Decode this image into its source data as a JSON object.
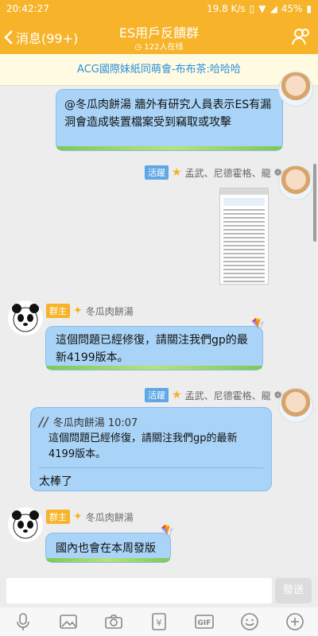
{
  "status": {
    "time": "20:42:27",
    "network": "19.8 K/s",
    "battery": "45%"
  },
  "header": {
    "back_label": "消息(99+)",
    "title": "ES用戶反饋群",
    "online": "122人在线"
  },
  "banner": {
    "text": "ACG國際妹紙同萌會-布布茶:哈哈哈"
  },
  "messages": [
    {
      "text": "@冬瓜肉餅湯 牆外有研究人員表示ES有漏洞會造成裝置檔案受到竊取或攻擊"
    },
    {
      "tag": "活躍",
      "sender": "孟武、尼德霍格、龍"
    },
    {
      "tag": "群主",
      "sender": "冬瓜肉餅湯",
      "text": "這個問題已經修復，請關注我們gp的最新4199版本。"
    },
    {
      "tag": "活躍",
      "sender": "孟武、尼德霍格、龍",
      "quote_author": "冬瓜肉餅湯 10:07",
      "quote_text": "這個問題已經修復，請關注我們gp的最新4199版本。",
      "reply": "太棒了"
    },
    {
      "tag": "群主",
      "sender": "冬瓜肉餅湯",
      "text": "國內也會在本周發版"
    }
  ],
  "input": {
    "placeholder": "",
    "send_label": "發送"
  },
  "toolbar": {
    "gif_label": "GIF",
    "money_label": "¥"
  },
  "colors": {
    "accent": "#f7b42a",
    "bubble": "#a9d4f7",
    "link": "#2e8fd8"
  }
}
